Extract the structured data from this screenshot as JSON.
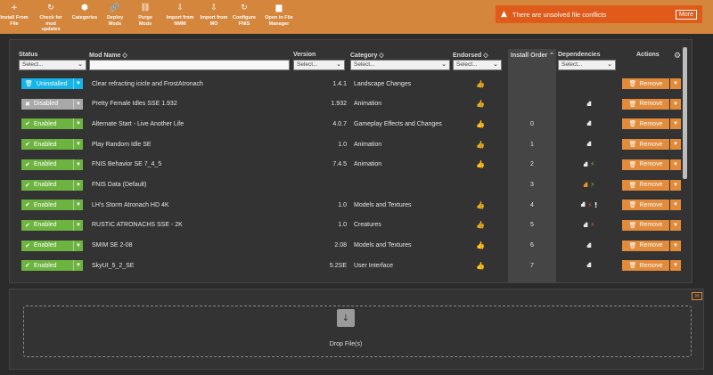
{
  "toolbar": {
    "buttons": [
      {
        "label": "Install From\nFile",
        "icon": "+"
      },
      {
        "label": "Check for\nmod updates",
        "icon": "↻"
      },
      {
        "label": "Categories",
        "icon": "⬢"
      },
      {
        "label": "Deploy Mods",
        "icon": "🔗"
      },
      {
        "label": "Purge Mods",
        "icon": "⛓"
      },
      {
        "label": "Import from\nNMM",
        "icon": "⇩"
      },
      {
        "label": "Import from\nMO",
        "icon": "⇩"
      },
      {
        "label": "Configure\nFNIS",
        "icon": "↻"
      },
      {
        "label": "Open in File\nManager",
        "icon": "▆"
      }
    ]
  },
  "notification": {
    "message": "There are unsolved file conflicts",
    "more_label": "More",
    "color": "#e05a1a"
  },
  "table": {
    "headers": {
      "status": "Status",
      "name": "Mod Name ◇",
      "version": "Version",
      "category": "Category ◇",
      "endorsed": "Endorsed ◇",
      "install_order": "Install Order ⌃",
      "dependencies": "Dependencies",
      "actions": "Actions"
    },
    "filters": {
      "status": "Select...",
      "name": "",
      "version": "Select...",
      "category": "Select...",
      "endorsed": "Select...",
      "dependencies": "Select..."
    },
    "remove_label": "Remove",
    "rows": [
      {
        "status": "Uninstalled",
        "status_type": "uninstalled",
        "name": "Clear refracting icicle and FrostAtronach",
        "version": "1.4.1",
        "category": "Landscape Changes",
        "endorsed": "outline",
        "order": "",
        "dep": "none"
      },
      {
        "status": "Disabled",
        "status_type": "disabled",
        "name": "Pretty Female Idles SSE 1.932",
        "version": "1.932",
        "category": "Animation",
        "endorsed": "outline",
        "order": "",
        "dep": "tree"
      },
      {
        "status": "Enabled",
        "status_type": "enabled",
        "name": "Alternate Start - Live Another Life",
        "version": "4.0.7",
        "category": "Gameplay Effects and Changes",
        "endorsed": "filled",
        "order": "0",
        "dep": "tree"
      },
      {
        "status": "Enabled",
        "status_type": "enabled",
        "name": "Play Random Idle SE",
        "version": "1.0",
        "category": "Animation",
        "endorsed": "outline",
        "order": "1",
        "dep": "tree"
      },
      {
        "status": "Enabled",
        "status_type": "enabled",
        "name": "FNIS Behavior SE 7_4_5",
        "version": "7.4.5",
        "category": "Animation",
        "endorsed": "filled",
        "order": "2",
        "dep": "tree-green"
      },
      {
        "status": "Enabled",
        "status_type": "enabled",
        "name": "FNIS Data (Default)",
        "version": "",
        "category": "",
        "endorsed": "none",
        "order": "3",
        "dep": "warn-green"
      },
      {
        "status": "Enabled",
        "status_type": "enabled",
        "name": "LH's Storm Atronach HD 4K",
        "version": "1.0",
        "category": "Models and Textures",
        "endorsed": "outline",
        "order": "4",
        "dep": "tree-red-exclaim"
      },
      {
        "status": "Enabled",
        "status_type": "enabled",
        "name": "RUSTIC ATRONACHS SSE - 2K",
        "version": "1.0",
        "category": "Creatures",
        "endorsed": "outline",
        "order": "5",
        "dep": "tree-red"
      },
      {
        "status": "Enabled",
        "status_type": "enabled",
        "name": "SMIM SE 2-08",
        "version": "2.08",
        "category": "Models and Textures",
        "endorsed": "filled",
        "order": "6",
        "dep": "tree"
      },
      {
        "status": "Enabled",
        "status_type": "enabled",
        "name": "SkyUI_5_2_SE",
        "version": "5.2SE",
        "category": "User Interface",
        "endorsed": "filled",
        "order": "7",
        "dep": "tree"
      }
    ]
  },
  "drop": {
    "label": "Drop File(s)"
  },
  "colors": {
    "accent": "#d4863c",
    "enabled": "#6db33f",
    "uninstalled": "#15b4ea",
    "disabled": "#a8a8a8",
    "remove": "#e28b3a"
  }
}
